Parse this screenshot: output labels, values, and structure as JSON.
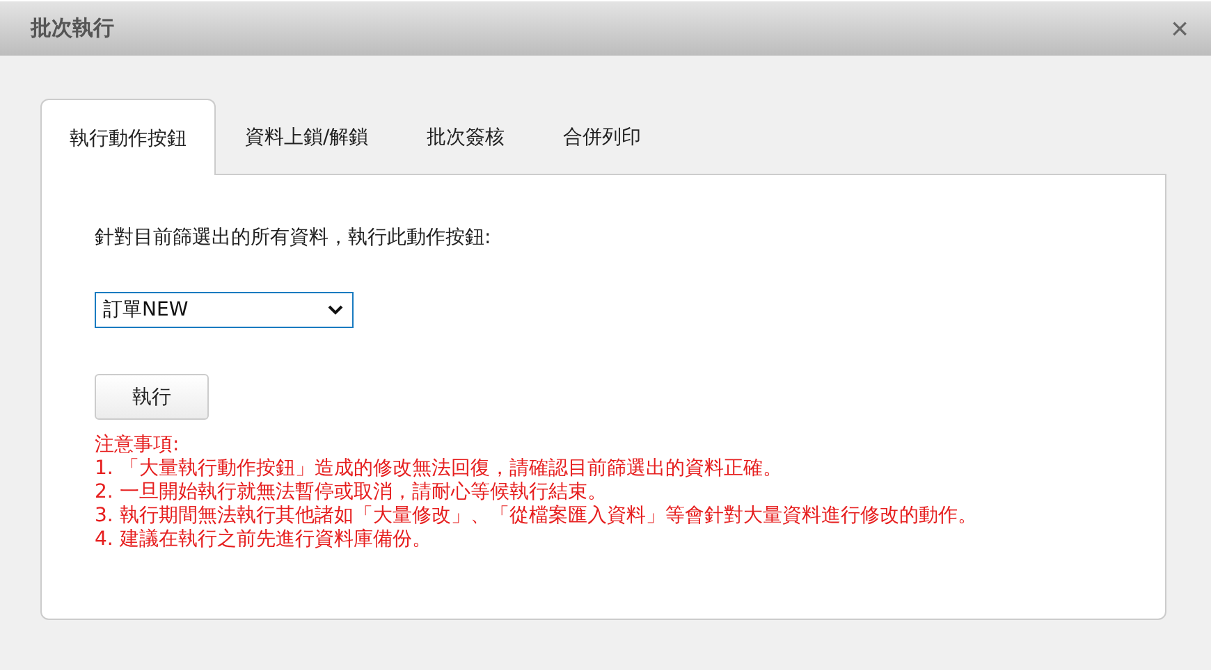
{
  "window": {
    "title": "批次執行",
    "close": "×"
  },
  "tabs": [
    {
      "label": "執行動作按鈕",
      "selected": true
    },
    {
      "label": "資料上鎖/解鎖",
      "selected": false
    },
    {
      "label": "批次簽核",
      "selected": false
    },
    {
      "label": "合併列印",
      "selected": false
    }
  ],
  "panel": {
    "instruction": "針對目前篩選出的所有資料，執行此動作按鈕:",
    "dropdown": {
      "value": "訂單NEW"
    },
    "button": "執行",
    "notes_title": "注意事項:",
    "notes": [
      "1. 「大量執行動作按鈕」造成的修改無法回復，請確認目前篩選出的資料正確。",
      "2. 一旦開始執行就無法暫停或取消，請耐心等候執行結束。",
      "3. 執行期間無法執行其他諸如「大量修改」、「從檔案匯入資料」等會針對大量資料進行修改的動作。",
      "4. 建議在執行之前先進行資料庫備份。"
    ]
  }
}
